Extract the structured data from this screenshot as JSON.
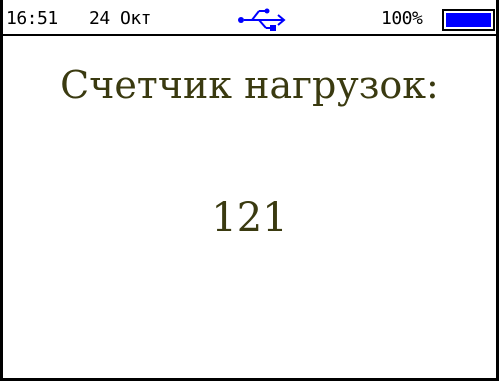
{
  "status_bar": {
    "time": "16:51",
    "date": "24 Окт",
    "usb_icon": "usb-icon",
    "battery_percent_label": "100%",
    "battery_level": 1.0,
    "battery_color": "#0000ff"
  },
  "main": {
    "title": "Счетчик нагрузок:",
    "value": "121",
    "text_color": "#3a3a10"
  }
}
